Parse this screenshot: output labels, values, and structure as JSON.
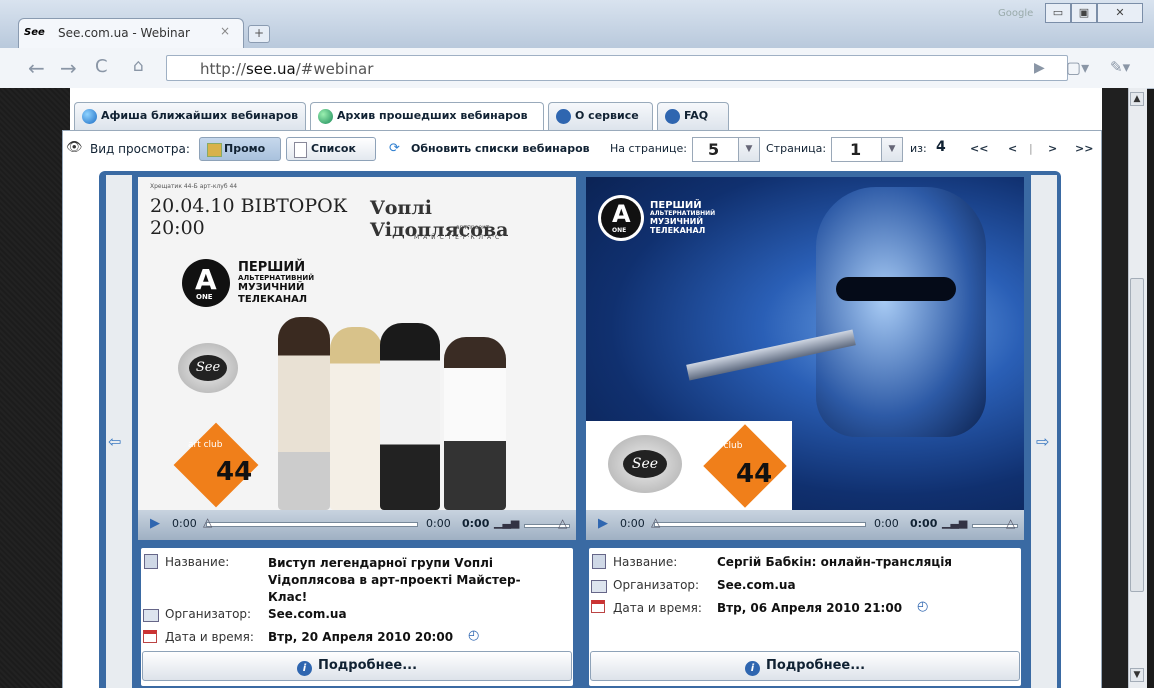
{
  "browser": {
    "tab_title": "See.com.ua - Webinar",
    "tab_close": "×",
    "new_tab": "+",
    "google_label": "Google",
    "url_host": "see.ua",
    "url_scheme": "http://",
    "url_path": "/#webinar",
    "win_min": "▭",
    "win_max": "▣",
    "win_close": "✕"
  },
  "site_tabs": [
    {
      "label": "Афиша ближайших вебинаров",
      "icon": "globe-icon"
    },
    {
      "label": "Архив прошедших вебинаров",
      "icon": "globe-icon"
    },
    {
      "label": "О сервисе",
      "icon": "info-icon"
    },
    {
      "label": "FAQ",
      "icon": "help-icon"
    }
  ],
  "controls": {
    "view_label": "Вид просмотра:",
    "promo_button": "Промо",
    "list_button": "Список",
    "refresh_label": "Обновить списки вебинаров",
    "per_page_label": "На странице:",
    "per_page_value": "5",
    "page_label": "Страница:",
    "page_value": "1",
    "of_label": "из:",
    "page_total": "4",
    "first": "<<",
    "prev": "<",
    "sep": "|",
    "next": ">",
    "last": ">>"
  },
  "cards": [
    {
      "poster": {
        "venue_line": "Хрещатик 44-Б  арт-клуб 44",
        "date_line1": "20.04.10 ВІВТОРОК",
        "date_line2": "20:00",
        "band": "Vоплі Vідоплясова",
        "project_small": "артпроект",
        "project": "М·А·Й·С·Т·Е·Р·К·Л·А·С",
        "channel": "ПЕРШИЙ",
        "channel2": "АЛЬТЕРНАТИВНИЙ",
        "channel3": "МУЗИЧНИЙ",
        "channel4": "ТЕЛЕКАНАЛ",
        "one": "ONE",
        "see": "See",
        "artclub": "art club",
        "num": "44"
      },
      "player": {
        "time": "0:00",
        "time_end": "0:00",
        "time_total": "0:00"
      },
      "name_label": "Название:",
      "name_value": "Виступ легендарної групи Vоплі Vідоплясова в арт-проекті Майстер-Клас!",
      "org_label": "Организатор:",
      "org_value": "See.com.ua",
      "date_label": "Дата и время:",
      "date_value": "Втр, 20 Апреля 2010 20:00",
      "more_button": "Подробнее..."
    },
    {
      "poster": {
        "channel": "ПЕРШИЙ",
        "channel2": "АЛЬТЕРНАТИВНИЙ",
        "channel3": "МУЗИЧНИЙ",
        "channel4": "ТЕЛЕКАНАЛ",
        "one": "ONE",
        "see": "See",
        "artclub": "art club",
        "num": "44"
      },
      "player": {
        "time": "0:00",
        "time_end": "0:00",
        "time_total": "0:00"
      },
      "name_label": "Название:",
      "name_value": "Сергій Бабкін: онлайн-трансляція",
      "org_label": "Организатор:",
      "org_value": "See.com.ua",
      "date_label": "Дата и время:",
      "date_value": "Втр, 06 Апреля 2010 21:00",
      "more_button": "Подробнее..."
    }
  ]
}
